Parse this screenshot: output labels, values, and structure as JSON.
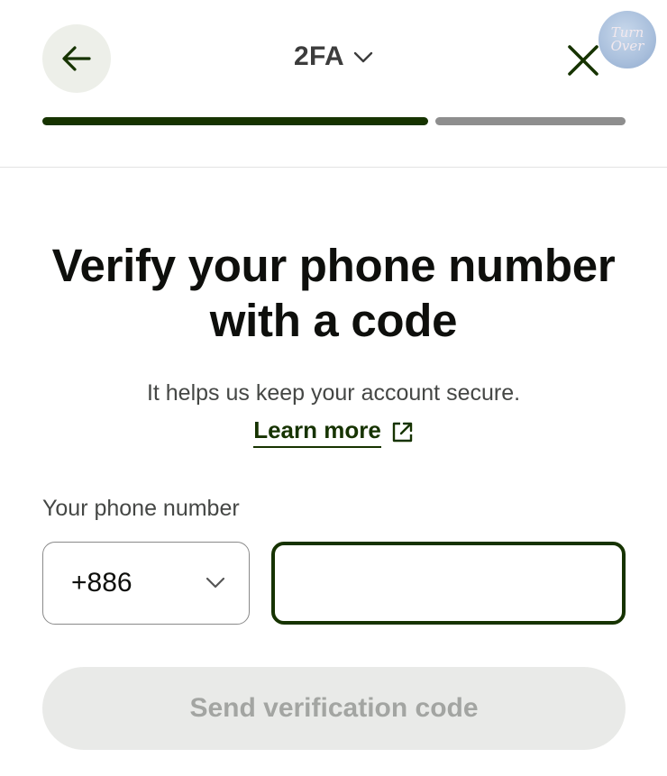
{
  "header": {
    "title": "2FA",
    "badge": {
      "line1": "Turn",
      "line2": "Over"
    }
  },
  "progress": {
    "completed_fraction": 0.67
  },
  "main": {
    "heading_line1": "Verify your phone number",
    "heading_line2": "with a code",
    "subtitle": "It helps us keep your account secure.",
    "learn_more": "Learn more"
  },
  "form": {
    "phone_label": "Your phone number",
    "country_code": "+886",
    "phone_value": ""
  },
  "actions": {
    "send_label": "Send verification code"
  },
  "colors": {
    "accent": "#163300",
    "progress_rest": "#8e8e8e",
    "disabled_button_bg": "#e9eae8",
    "disabled_button_text": "#a3a5a2"
  },
  "icons": [
    "arrow-left-icon",
    "chevron-down-icon",
    "close-icon",
    "external-link-icon"
  ]
}
